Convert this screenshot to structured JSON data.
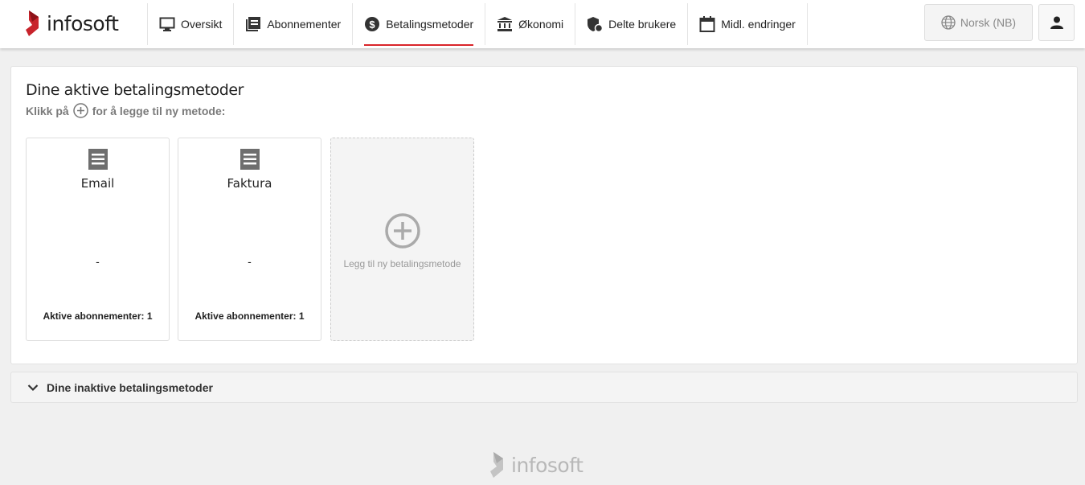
{
  "brand": {
    "name": "infosoft",
    "accent": "#d9252a"
  },
  "nav": [
    {
      "label": "Oversikt",
      "icon": "monitor-icon"
    },
    {
      "label": "Abonnementer",
      "icon": "list-icon"
    },
    {
      "label": "Betalingsmetoder",
      "icon": "dollar-icon",
      "active": true
    },
    {
      "label": "Økonomi",
      "icon": "bank-icon"
    },
    {
      "label": "Delte brukere",
      "icon": "shield-user-icon"
    },
    {
      "label": "Midl. endringer",
      "icon": "calendar-icon"
    }
  ],
  "language": "Norsk (NB)",
  "active": {
    "title": "Dine aktive betalingsmetoder",
    "sub_before": "Klikk på",
    "sub_after": "for å legge til ny metode:",
    "cards": [
      {
        "name": "Email",
        "detail": "-",
        "subs": "Aktive abonnementer: 1"
      },
      {
        "name": "Faktura",
        "detail": "-",
        "subs": "Aktive abonnementer: 1"
      }
    ],
    "add_label": "Legg til ny betalingsmetode"
  },
  "inactive": {
    "title": "Dine inaktive betalingsmetoder"
  }
}
